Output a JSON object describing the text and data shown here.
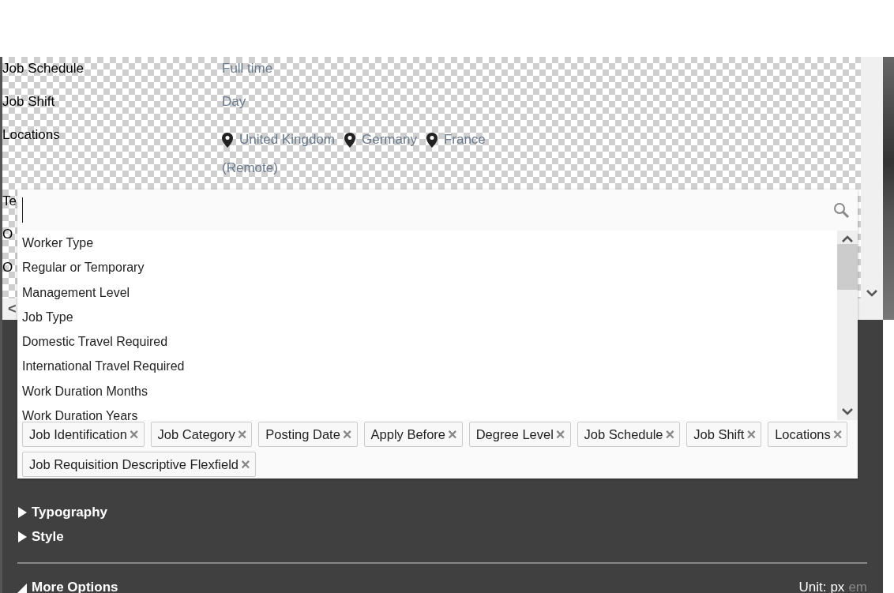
{
  "preview": {
    "rows": [
      {
        "label": "Job Schedule",
        "kind": "text",
        "values": [
          "Full time"
        ]
      },
      {
        "label": "Job Shift",
        "kind": "text",
        "values": [
          "Day"
        ]
      },
      {
        "label": "Locations",
        "kind": "locations",
        "values": [
          "United Kingdom",
          "Germany",
          "France"
        ]
      },
      {
        "kind": "text",
        "values": [
          "(Remote)"
        ]
      }
    ],
    "covered_labels": [
      "Te",
      "O",
      "O"
    ],
    "scroll_left": "<"
  },
  "picker": {
    "options": [
      "Worker Type",
      "Regular or Temporary",
      "Management Level",
      "Job Type",
      "Domestic Travel Required",
      "International Travel Required",
      "Work Duration Months",
      "Work Duration Years"
    ],
    "selected_fields": [
      "Job Identification",
      "Job Category",
      "Posting Date",
      "Apply Before",
      "Degree Level",
      "Job Schedule",
      "Job Shift",
      "Locations",
      "Job Requisition Descriptive Flexfield"
    ],
    "remove_glyph": "×"
  },
  "panel": {
    "sections": [
      {
        "label": "Typography",
        "expanded": false
      },
      {
        "label": "Style",
        "expanded": false
      }
    ],
    "more": {
      "label": "More Options",
      "expanded": true
    },
    "unit": {
      "label": "Unit:",
      "options": [
        {
          "label": "px",
          "selected": true
        },
        {
          "label": "em",
          "selected": false
        }
      ]
    }
  }
}
